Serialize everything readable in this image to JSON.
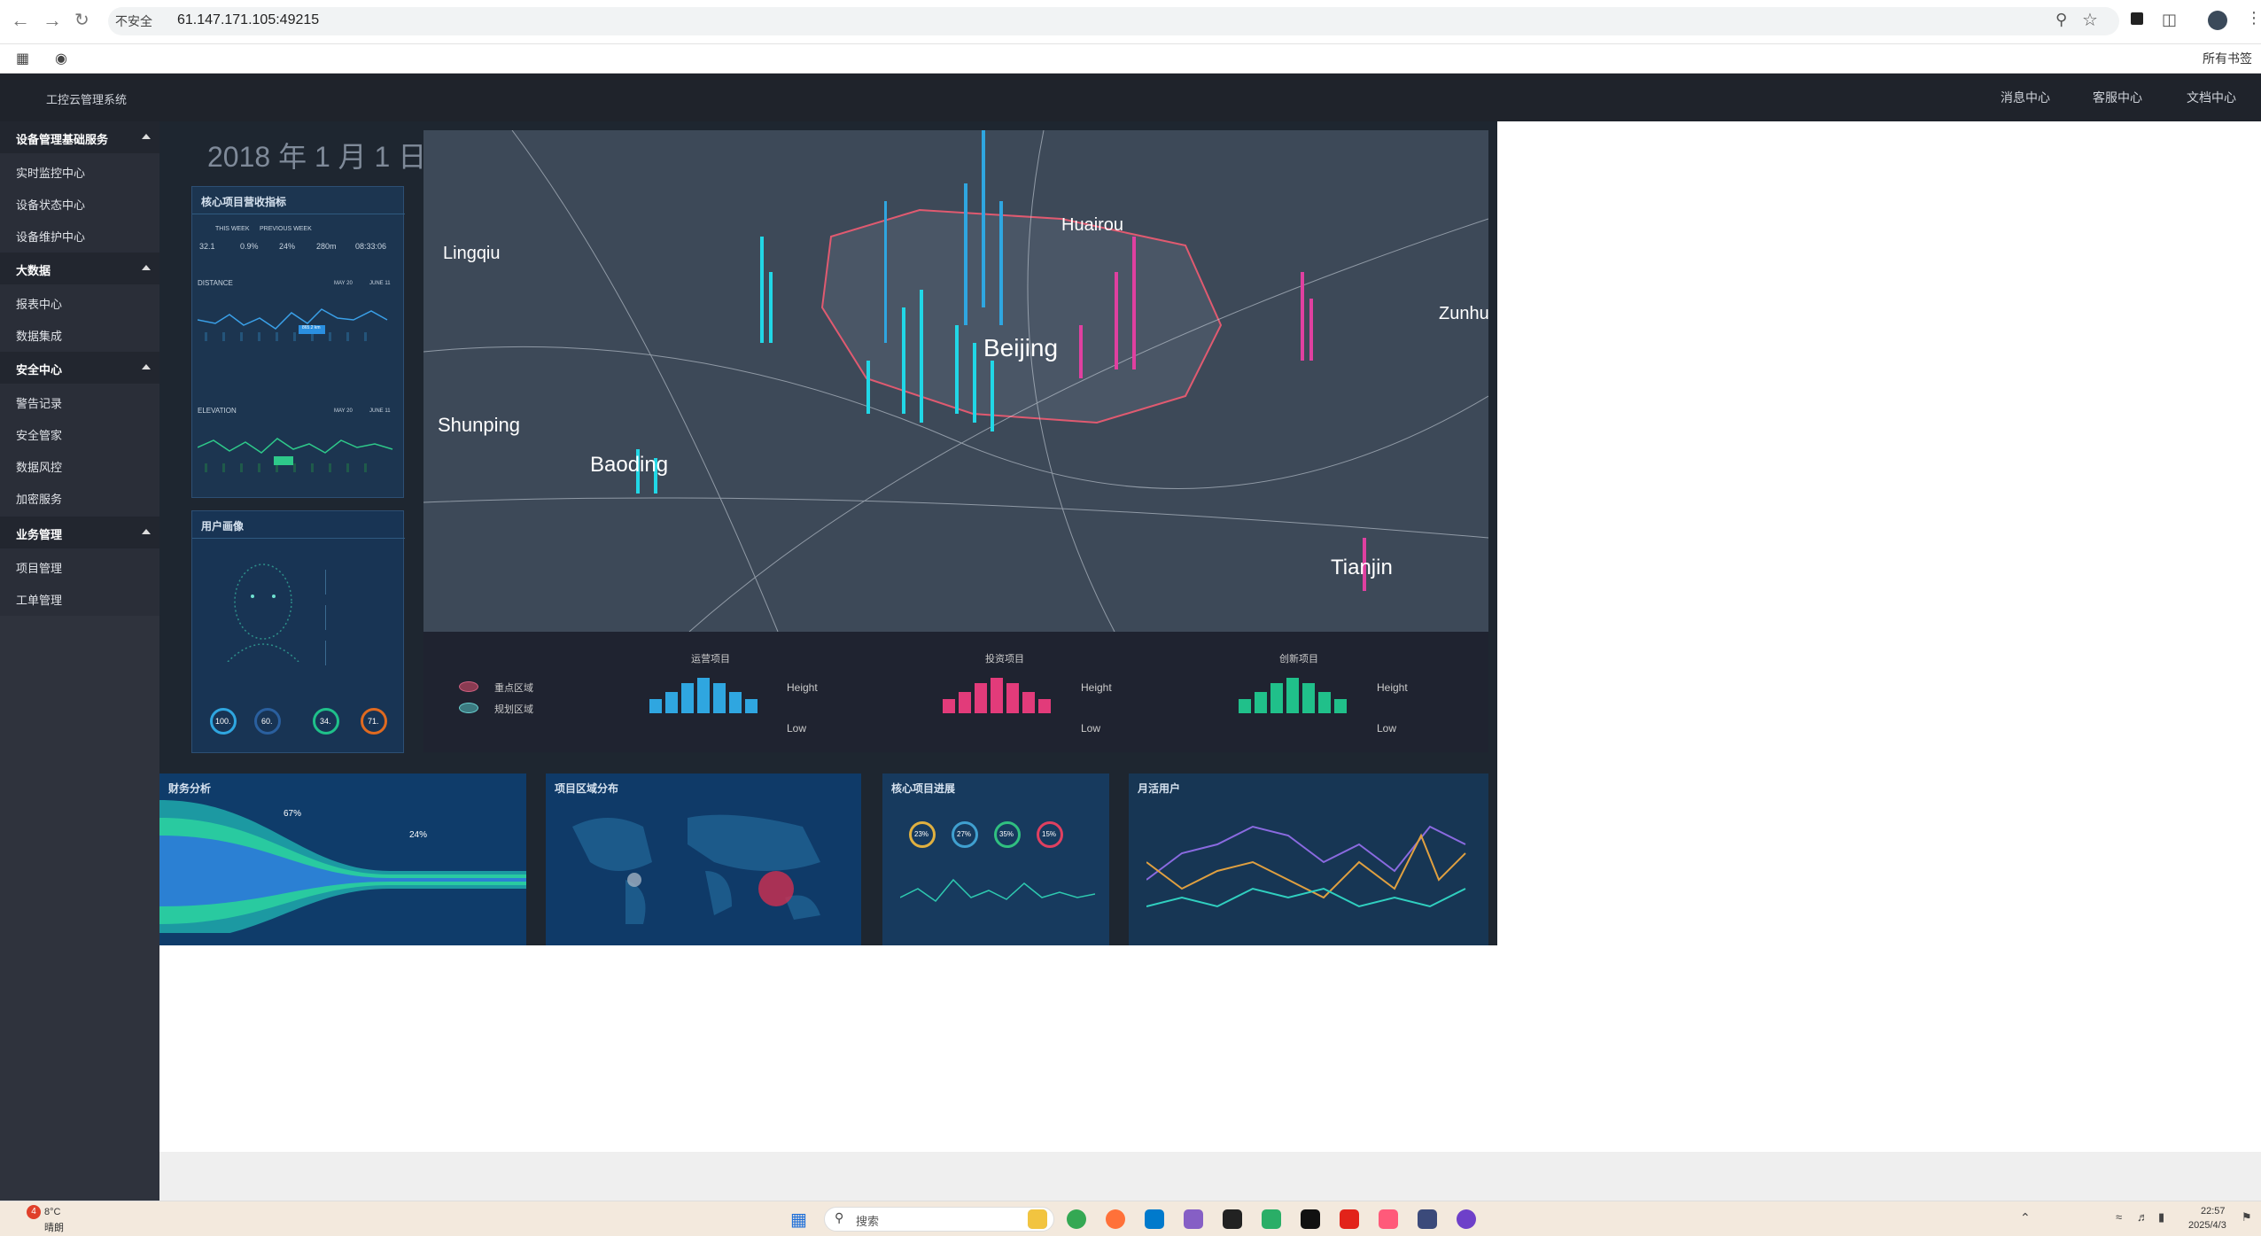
{
  "browser": {
    "insecure_label": "不安全",
    "url": "61.147.171.105:49215",
    "bookmarks_label": "所有书签"
  },
  "header": {
    "title": "工控云管理系统",
    "links": [
      "消息中心",
      "客服中心",
      "文档中心"
    ]
  },
  "sidebar": {
    "groups": [
      {
        "label": "设备管理基础服务",
        "items": [
          "实时监控中心",
          "设备状态中心",
          "设备维护中心"
        ]
      },
      {
        "label": "大数据",
        "items": [
          "报表中心",
          "数据集成"
        ]
      },
      {
        "label": "安全中心",
        "items": [
          "警告记录",
          "安全管家",
          "数据风控",
          "加密服务"
        ]
      },
      {
        "label": "业务管理",
        "items": [
          "项目管理",
          "工单管理"
        ]
      }
    ]
  },
  "dashboard": {
    "date": "2018 年 1 月 1 日",
    "kpi_panel": {
      "title": "核心项目营收指标",
      "labels": [
        "THIS WEEK",
        "PREVIOUS WEEK"
      ],
      "stats": [
        "32.1",
        "0.9%",
        "24%",
        "280m",
        "08:33:06"
      ],
      "distance_label": "DISTANCE",
      "elevation_label": "ELEVATION",
      "tooltip_distance": "865.2 km",
      "legend_a": "MAY 20",
      "legend_b": "JUNE 11"
    },
    "user_panel": {
      "title": "用户画像",
      "gauges": [
        "100.",
        "60.",
        "34.",
        "71."
      ]
    },
    "map": {
      "cities": [
        "Lingqiu",
        "Huairou",
        "Beijing",
        "Zunhua",
        "Shunping",
        "Baoding",
        "Tianjin"
      ]
    },
    "legend": {
      "areas": [
        "重点区域",
        "规划区域"
      ],
      "groups": [
        {
          "title": "运营项目",
          "color": "#2fa6e0"
        },
        {
          "title": "投资项目",
          "color": "#e23b7a"
        },
        {
          "title": "创新项目",
          "color": "#20c08a"
        }
      ],
      "high": "Height",
      "low": "Low"
    },
    "bottom": {
      "finance_title": "财务分析",
      "finance_pct1": "67%",
      "finance_pct2": "24%",
      "region_title": "项目区域分布",
      "progress_title": "核心项目进展",
      "progress_values": [
        "23%",
        "27%",
        "35%",
        "15%"
      ],
      "monthly_title": "月活用户"
    }
  },
  "taskbar": {
    "weather_temp": "8°C",
    "weather_desc": "晴朗",
    "search_placeholder": "搜索",
    "time": "22:57",
    "date": "2025/4/3",
    "badge": "4"
  }
}
